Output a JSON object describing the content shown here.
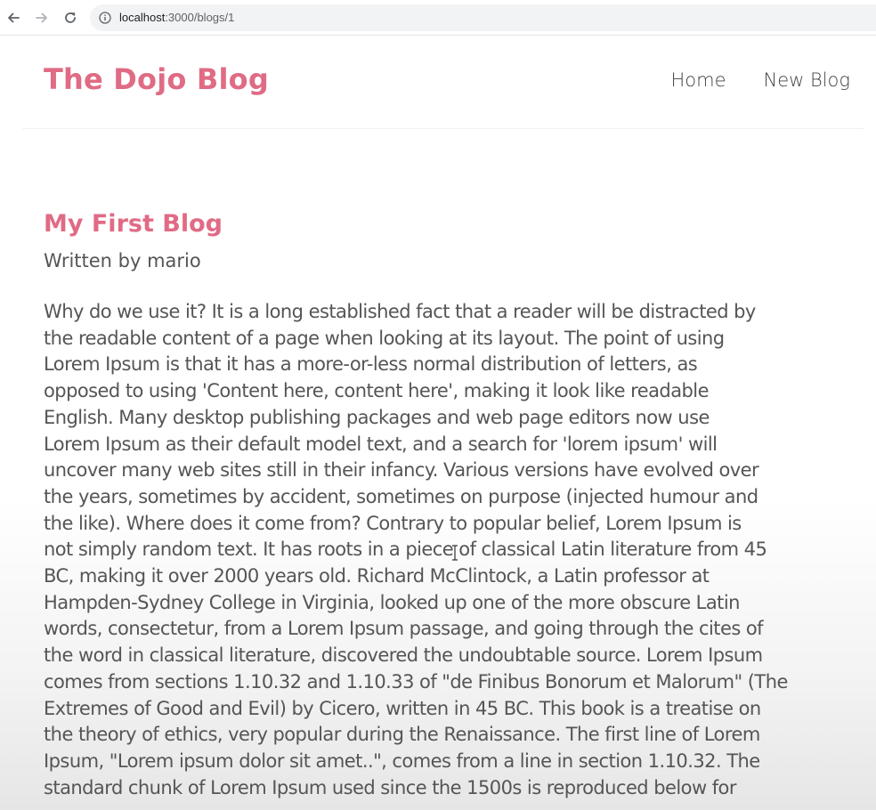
{
  "browser": {
    "url_host": "localhost",
    "url_path": ":3000/blogs/1",
    "icons": [
      "back-arrow-icon",
      "forward-arrow-icon",
      "reload-icon",
      "info-icon"
    ]
  },
  "site": {
    "logo": "The Dojo Blog",
    "nav": [
      {
        "label": "Home"
      },
      {
        "label": "New Blog"
      }
    ],
    "accent_color": "#e06b85",
    "text_color": "#555555"
  },
  "blog": {
    "title": "My First Blog",
    "author_line": "Written by mario",
    "body_lines": [
      "Why do we use it? It is a long established fact that a reader will be distracted by",
      "the readable content of a page when looking at its layout. The point of using",
      "Lorem Ipsum is that it has a more-or-less normal distribution of letters, as",
      "opposed to using 'Content here, content here', making it look like readable",
      "English. Many desktop publishing packages and web page editors now use",
      "Lorem Ipsum as their default model text, and a search for 'lorem ipsum' will",
      "uncover many web sites still in their infancy. Various versions have evolved over",
      "the years, sometimes by accident, sometimes on purpose (injected humour and",
      "the like). Where does it come from? Contrary to popular belief, Lorem Ipsum is",
      "not simply random text. It has roots in a piece of classical Latin literature from 45",
      "BC, making it over 2000 years old. Richard McClintock, a Latin professor at",
      "Hampden-Sydney College in Virginia, looked up one of the more obscure Latin",
      "words, consectetur, from a Lorem Ipsum passage, and going through the cites of",
      "the word in classical literature, discovered the undoubtable source. Lorem Ipsum",
      "comes from sections 1.10.32 and 1.10.33 of \"de Finibus Bonorum et Malorum\" (The",
      "Extremes of Good and Evil) by Cicero, written in 45 BC. This book is a treatise on",
      "the theory of ethics, very popular during the Renaissance. The first line of Lorem",
      "Ipsum, \"Lorem ipsum dolor sit amet..\", comes from a line in section 1.10.32. The",
      "standard chunk of Lorem Ipsum used since the 1500s is reproduced below for"
    ]
  }
}
